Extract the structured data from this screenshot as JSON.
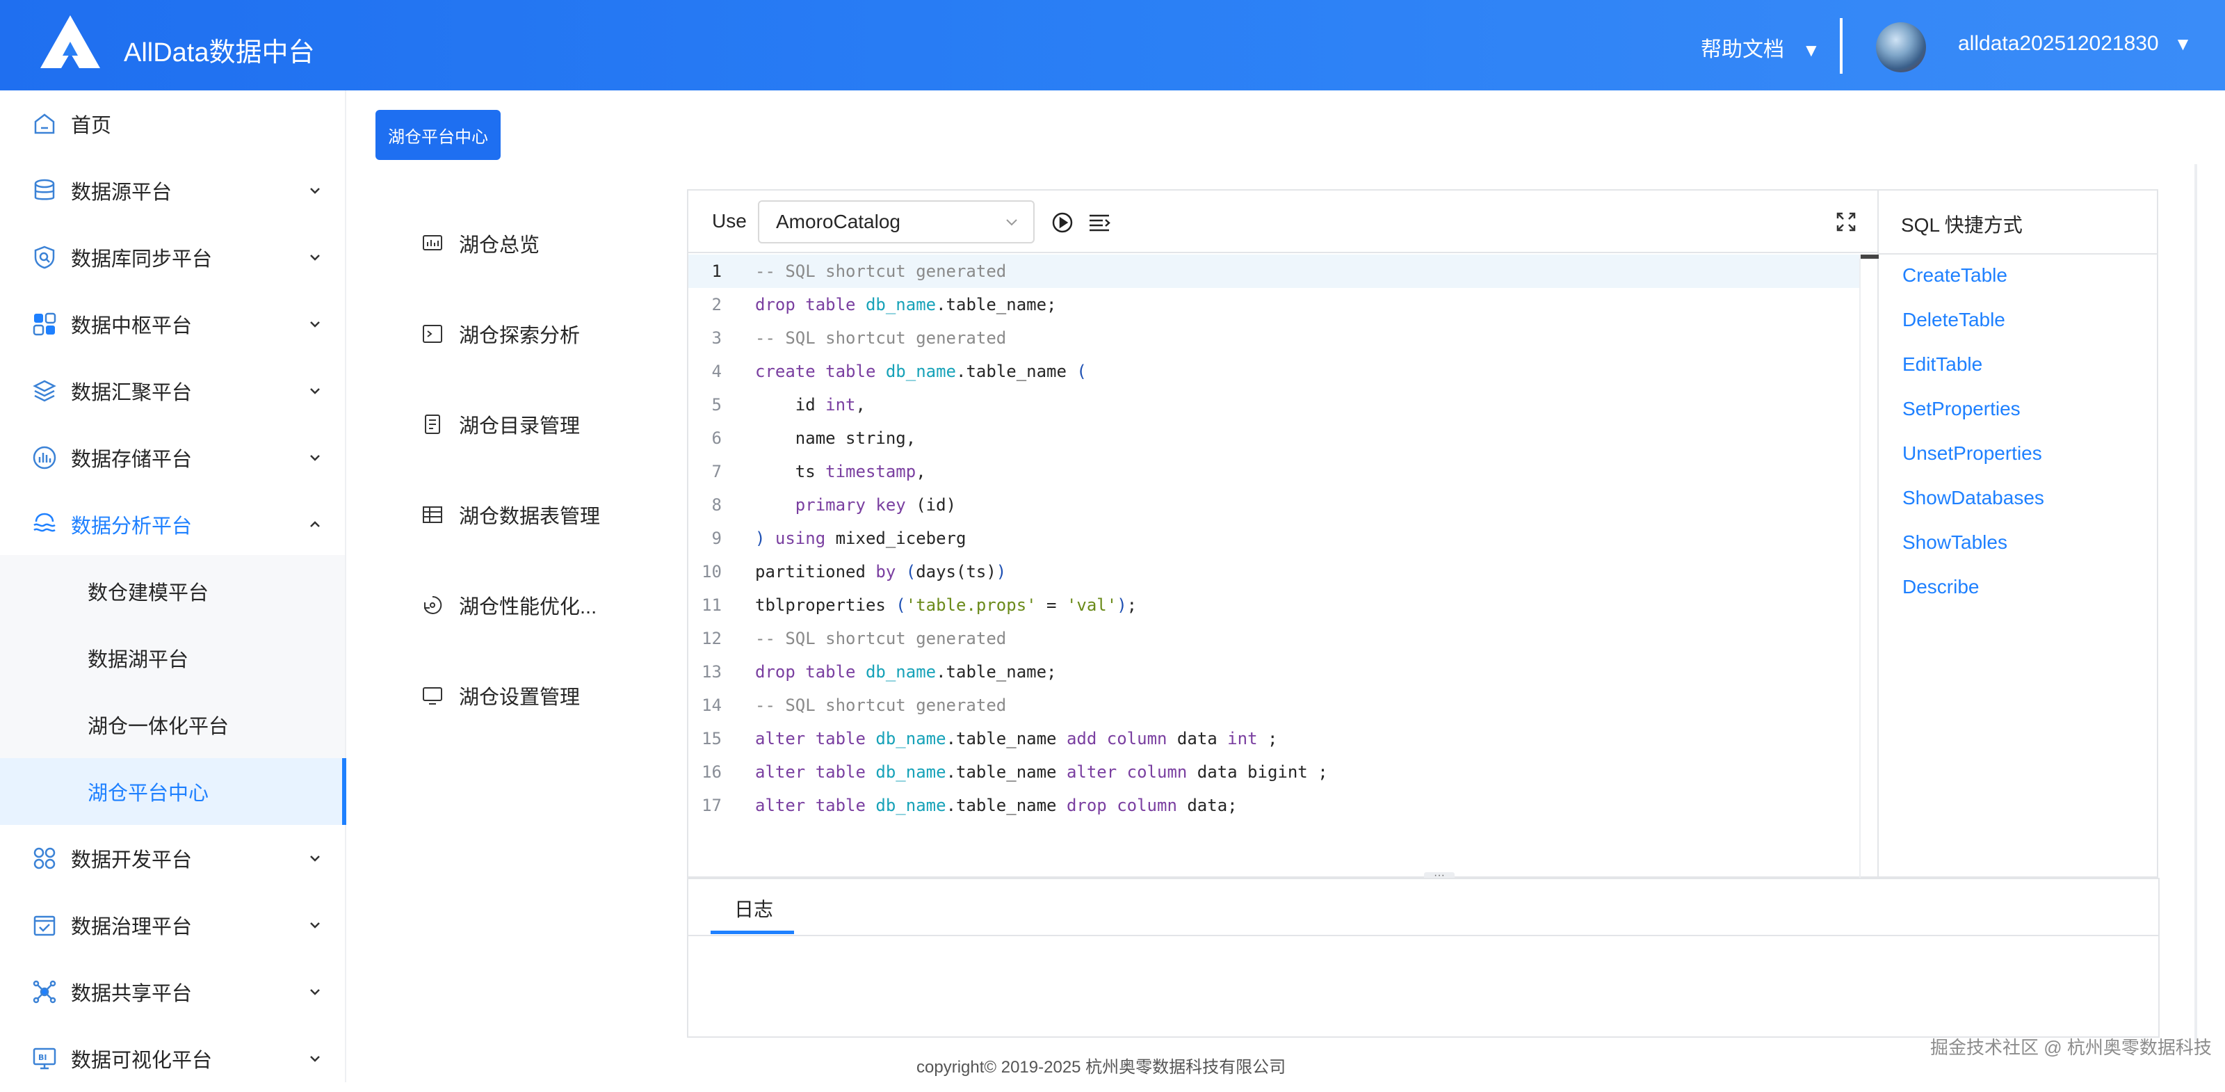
{
  "header": {
    "title": "AllData数据中台",
    "help_label": "帮助文档",
    "username": "alldata202512021830",
    "caret": "▼"
  },
  "sidebar": {
    "items": [
      {
        "label": "首页",
        "icon": "home-icon"
      },
      {
        "label": "数据源平台",
        "icon": "database-icon"
      },
      {
        "label": "数据库同步平台",
        "icon": "sync-search-icon"
      },
      {
        "label": "数据中枢平台",
        "icon": "grid-blocks-icon"
      },
      {
        "label": "数据汇聚平台",
        "icon": "layers-icon"
      },
      {
        "label": "数据存储平台",
        "icon": "bar-storage-icon"
      },
      {
        "label": "数据分析平台",
        "icon": "analysis-waves-icon"
      },
      {
        "label": "数据开发平台",
        "icon": "dev-clusters-icon"
      },
      {
        "label": "数据治理平台",
        "icon": "governance-check-icon"
      },
      {
        "label": "数据共享平台",
        "icon": "share-network-icon"
      },
      {
        "label": "数据可视化平台",
        "icon": "bi-screen-icon"
      }
    ],
    "sub_items": [
      "数仓建模平台",
      "数据湖平台",
      "湖仓一体化平台",
      "湖仓平台中心"
    ]
  },
  "main": {
    "tag_button": "湖仓平台中心",
    "subnav": [
      {
        "label": "湖仓总览",
        "icon": "dashboard-icon"
      },
      {
        "label": "湖仓探索分析",
        "icon": "terminal-icon"
      },
      {
        "label": "湖仓目录管理",
        "icon": "catalog-icon"
      },
      {
        "label": "湖仓数据表管理",
        "icon": "table-icon"
      },
      {
        "label": "湖仓性能优化...",
        "icon": "optimize-icon"
      },
      {
        "label": "湖仓设置管理",
        "icon": "monitor-icon"
      }
    ]
  },
  "editor": {
    "use_label": "Use",
    "catalog_value": "AmoroCatalog",
    "line_numbers": [
      "1",
      "2",
      "3",
      "4",
      "5",
      "6",
      "7",
      "8",
      "9",
      "10",
      "11",
      "12",
      "13",
      "14",
      "15",
      "16",
      "17"
    ]
  },
  "log": {
    "tab_label": "日志"
  },
  "shortcuts": {
    "title": "SQL 快捷方式",
    "links": [
      "CreateTable",
      "DeleteTable",
      "EditTable",
      "SetProperties",
      "UnsetProperties",
      "ShowDatabases",
      "ShowTables",
      "Describe"
    ]
  },
  "footer": {
    "copyright": "copyright© 2019-2025 杭州奥零数据科技有限公司",
    "watermark": "掘金技术社区 @ 杭州奥零数据科技"
  },
  "colors": {
    "accent": "#1e80ff",
    "header": "#2a7ff5"
  }
}
